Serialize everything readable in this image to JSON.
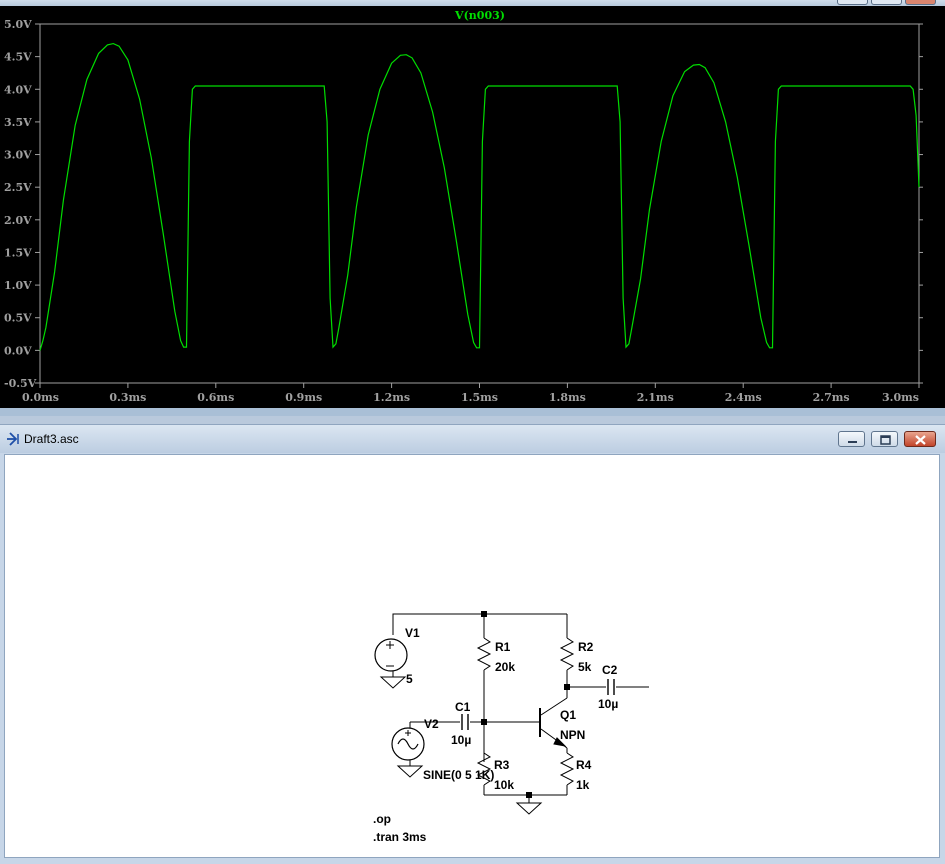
{
  "waveform": {
    "trace_name": "V(n003)",
    "trace_color": "#00dd00",
    "background": "#000000"
  },
  "chart_data": {
    "type": "line",
    "title": "V(n003)",
    "xlabel": "",
    "ylabel": "",
    "xlim": [
      0,
      3.0
    ],
    "ylim": [
      -0.5,
      5.0
    ],
    "x_unit": "ms",
    "y_unit": "V",
    "y_ticks": [
      "5.0V",
      "4.5V",
      "4.0V",
      "3.5V",
      "3.0V",
      "2.5V",
      "2.0V",
      "1.5V",
      "1.0V",
      "0.5V",
      "0.0V",
      "-0.5V"
    ],
    "x_ticks": [
      "0.0ms",
      "0.3ms",
      "0.6ms",
      "0.9ms",
      "1.2ms",
      "1.5ms",
      "1.8ms",
      "2.1ms",
      "2.4ms",
      "2.7ms",
      "3.0ms"
    ],
    "grid": false,
    "series": [
      {
        "name": "V(n003)",
        "x": [
          0.0,
          0.01,
          0.02,
          0.05,
          0.08,
          0.12,
          0.16,
          0.2,
          0.23,
          0.25,
          0.27,
          0.3,
          0.34,
          0.38,
          0.42,
          0.46,
          0.48,
          0.49,
          0.5,
          0.51,
          0.52,
          0.53,
          0.55,
          0.6,
          0.7,
          0.8,
          0.9,
          0.97,
          0.98,
          0.99,
          1.0,
          1.01,
          1.02,
          1.05,
          1.08,
          1.12,
          1.16,
          1.2,
          1.23,
          1.25,
          1.27,
          1.3,
          1.34,
          1.38,
          1.42,
          1.46,
          1.48,
          1.49,
          1.5,
          1.51,
          1.52,
          1.53,
          1.55,
          1.6,
          1.7,
          1.8,
          1.9,
          1.97,
          1.98,
          1.99,
          2.0,
          2.01,
          2.02,
          2.05,
          2.08,
          2.12,
          2.16,
          2.2,
          2.23,
          2.25,
          2.27,
          2.3,
          2.34,
          2.38,
          2.42,
          2.46,
          2.48,
          2.49,
          2.5,
          2.51,
          2.52,
          2.53,
          2.55,
          2.6,
          2.7,
          2.8,
          2.9,
          2.97,
          2.98,
          2.99,
          3.0
        ],
        "y": [
          0.0,
          0.15,
          0.35,
          1.2,
          2.3,
          3.45,
          4.15,
          4.55,
          4.68,
          4.7,
          4.66,
          4.45,
          3.85,
          2.95,
          1.8,
          0.6,
          0.15,
          0.05,
          0.05,
          3.2,
          4.0,
          4.05,
          4.05,
          4.05,
          4.05,
          4.05,
          4.05,
          4.05,
          3.5,
          0.8,
          0.05,
          0.1,
          0.35,
          1.15,
          2.2,
          3.3,
          4.0,
          4.4,
          4.52,
          4.53,
          4.48,
          4.25,
          3.65,
          2.8,
          1.7,
          0.55,
          0.12,
          0.04,
          0.04,
          3.2,
          4.0,
          4.05,
          4.05,
          4.05,
          4.05,
          4.05,
          4.05,
          4.05,
          3.5,
          0.8,
          0.05,
          0.1,
          0.35,
          1.1,
          2.15,
          3.2,
          3.9,
          4.27,
          4.37,
          4.38,
          4.33,
          4.1,
          3.5,
          2.65,
          1.6,
          0.5,
          0.12,
          0.04,
          0.04,
          3.2,
          4.0,
          4.05,
          4.05,
          4.05,
          4.05,
          4.05,
          4.05,
          4.05,
          4.0,
          3.6,
          2.5
        ]
      }
    ]
  },
  "schematic_window": {
    "title": "Draft3.asc",
    "minimize_label": "minimize",
    "restore_label": "restore",
    "close_label": "close"
  },
  "schematic": {
    "components": {
      "v1": {
        "name": "V1",
        "value": "5"
      },
      "v2": {
        "name": "V2",
        "value": "SINE(0 5 1K)"
      },
      "r1": {
        "name": "R1",
        "value": "20k"
      },
      "r2": {
        "name": "R2",
        "value": "5k"
      },
      "r3": {
        "name": "R3",
        "value": "10k"
      },
      "r4": {
        "name": "R4",
        "value": "1k"
      },
      "c1": {
        "name": "C1",
        "value": "10µ"
      },
      "c2": {
        "name": "C2",
        "value": "10µ"
      },
      "q1": {
        "name": "Q1",
        "value": "NPN"
      }
    },
    "directives": [
      ".op",
      ".tran 3ms"
    ]
  }
}
